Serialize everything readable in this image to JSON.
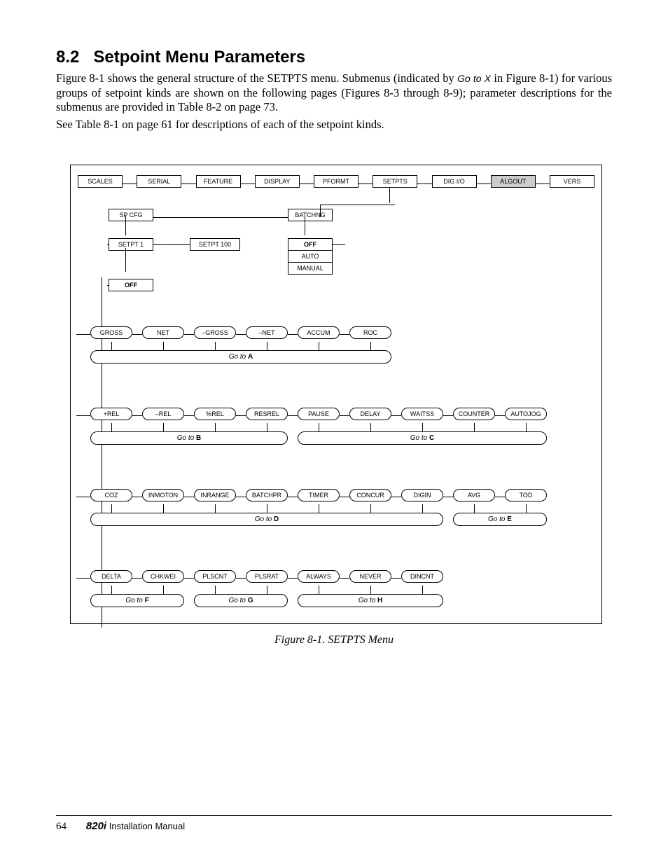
{
  "heading": {
    "number": "8.2",
    "title": "Setpoint Menu Parameters"
  },
  "para1_a": "Figure 8-1 shows the general structure of the SETPTS menu. Submenus (indicated by ",
  "para1_goto": "Go to X",
  "para1_b": " in Figure 8-1) for various groups of setpoint kinds are shown on the following pages (Figures 8-3 through 8-9); parameter descriptions for the submenus are provided in Table 8-2 on page 73.",
  "para2": "See Table 8-1 on page 61 for descriptions of each of the setpoint kinds.",
  "top_menu": [
    "SCALES",
    "SERIAL",
    "FEATURE",
    "DISPLAY",
    "PFORMT",
    "SETPTS",
    "DIG I/O",
    "ALGOUT",
    "VERS"
  ],
  "top_shaded_index": 7,
  "row2": {
    "spcfg": "SP CFG",
    "batchng": "BATCHNG"
  },
  "row3": {
    "setpt1": "SETPT 1",
    "ellipsis": "…",
    "setpt100": "SETPT 100",
    "off": "OFF",
    "auto": "AUTO",
    "manual": "MANUAL"
  },
  "off_box": "OFF",
  "group_a": {
    "nodes": [
      "GROSS",
      "NET",
      "–GROSS",
      "–NET",
      "ACCUM",
      "ROC"
    ],
    "goto": "A"
  },
  "group_bc": {
    "nodes": [
      "+REL",
      "–REL",
      "%REL",
      "RESREL",
      "PAUSE",
      "DELAY",
      "WAITSS",
      "COUNTER",
      "AUTOJOG"
    ],
    "goto_left": "B",
    "goto_right": "C",
    "split_after": 4
  },
  "group_de": {
    "nodes": [
      "COZ",
      "INMOTON",
      "INRANGE",
      "BATCHPR",
      "TIMER",
      "CONCUR",
      "DIGIN",
      "AVG",
      "TOD"
    ],
    "goto_left": "D",
    "goto_right": "E",
    "split_after": 7
  },
  "group_fgh": {
    "nodes": [
      "DELTA",
      "CHKWEI",
      "PLSCNT",
      "PLSRAT",
      "ALWAYS",
      "NEVER",
      "DINCNT"
    ],
    "gotos": [
      {
        "label": "F",
        "start": 0,
        "end": 2
      },
      {
        "label": "G",
        "start": 2,
        "end": 4
      },
      {
        "label": "H",
        "start": 4,
        "end": 7
      }
    ]
  },
  "caption": "Figure 8-1. SETPTS Menu",
  "goto_prefix": "Go to ",
  "footer": {
    "page": "64",
    "model": "820i",
    "title": " Installation Manual"
  }
}
